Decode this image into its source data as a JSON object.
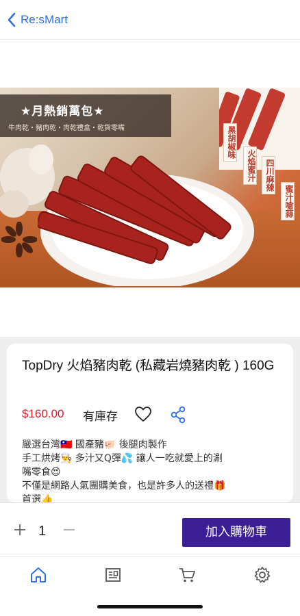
{
  "header": {
    "back_label": "Re:sMart"
  },
  "hero": {
    "banner_title": "★月熱銷萬包★",
    "banner_sub": "牛肉乾・豬肉乾・肉乾禮盒・乾貨零嘴",
    "tags": [
      "黑胡椒味",
      "火焰蜜汁",
      "四川麻辣",
      "蜜汁嗆蒜"
    ]
  },
  "product": {
    "title": "TopDry 火焰豬肉乾 (私藏岩燒豬肉乾 ) 160G",
    "price": "$160.00",
    "stock": "有庫存",
    "description": [
      "嚴選台灣🇹🇼 國產豬🐖 後腿肉製作",
      "手工烘烤👨‍🍳 多汁又Q彈💦 讓人一吃就愛上的涮",
      "嘴零食😍",
      "不僅是網路人氣團購美食，也是許多人的送禮🎁",
      "首選👍"
    ]
  },
  "cart": {
    "quantity": "1",
    "add_label": "加入購物車"
  },
  "tabs": [
    {
      "name": "home-icon"
    },
    {
      "name": "news-icon"
    },
    {
      "name": "cart-icon"
    },
    {
      "name": "settings-icon"
    }
  ],
  "colors": {
    "accent_blue": "#2f6fe0",
    "price_red": "#d4202c",
    "button_purple": "#3c1f96"
  }
}
